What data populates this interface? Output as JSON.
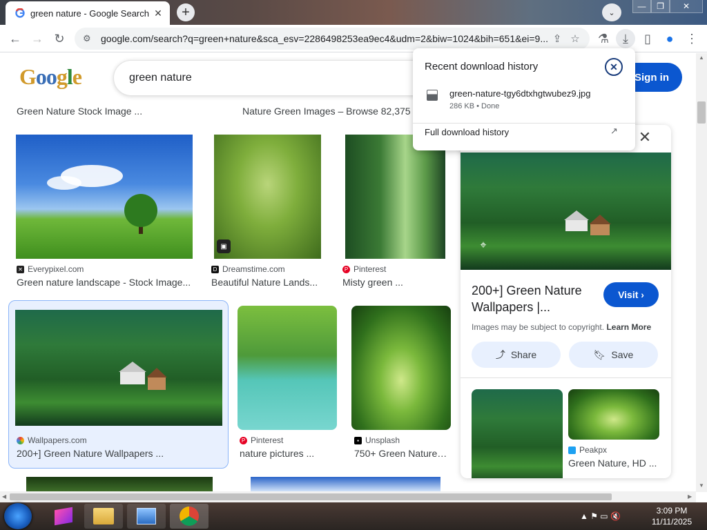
{
  "browser": {
    "tab_title": "green nature - Google Search",
    "tab_close": "✕",
    "new_tab": "+",
    "tab_list": "⌄",
    "window_min": "—",
    "window_max": "❐",
    "window_close": "✕",
    "url": "google.com/search?q=green+nature&sca_esv=2286498253ea9ec4&udm=2&biw=1024&bih=651&ei=9...",
    "back": "←",
    "forward": "→",
    "reload": "↻",
    "tune_icon": "⚙",
    "share_icon": "⇪",
    "star_icon": "☆",
    "lab_icon": "⚗",
    "download_icon": "⤓",
    "sidepanel_icon": "▯",
    "profile_icon": "●",
    "menu_icon": "⋮"
  },
  "search": {
    "logo": [
      "G",
      "o",
      "o",
      "g",
      "l",
      "e"
    ],
    "query": "green nature",
    "sign_in": "Sign in"
  },
  "results": {
    "top_captions": [
      "Green Nature Stock Image ...",
      "Nature Green Images – Browse 82,375"
    ],
    "row1": [
      {
        "source": "Everypixel.com",
        "caption": "Green nature landscape - Stock Image..."
      },
      {
        "source": "Dreamstime.com",
        "caption": "Beautiful Nature Lands..."
      },
      {
        "source": "Pinterest",
        "caption": "Misty green ..."
      }
    ],
    "row2": [
      {
        "source": "Wallpapers.com",
        "caption": "200+] Green Nature Wallpapers ..."
      },
      {
        "source": "Pinterest",
        "caption": "nature pictures ..."
      },
      {
        "source": "Unsplash",
        "caption": "750+ Green Nature ..."
      }
    ]
  },
  "panel": {
    "title": "200+] Green Nature Wallpapers |...",
    "visit": "Visit ›",
    "copyright": "Images may be subject to copyright.",
    "learn_more": "Learn More",
    "share": "Share",
    "save": "Save",
    "close": "✕",
    "related_source": "Peakpx",
    "related_caption": "Green Nature, HD ..."
  },
  "downloads": {
    "title": "Recent download history",
    "filename": "green-nature-tgy6dtxhgtwubez9.jpg",
    "meta": "286 KB • Done",
    "full_history": "Full download history",
    "close": "✕",
    "open_icon": "↗"
  },
  "taskbar": {
    "time": "3:09 PM",
    "date": "11/11/2025",
    "tray_icons": "▲  ⚑  ▭  🔇"
  }
}
